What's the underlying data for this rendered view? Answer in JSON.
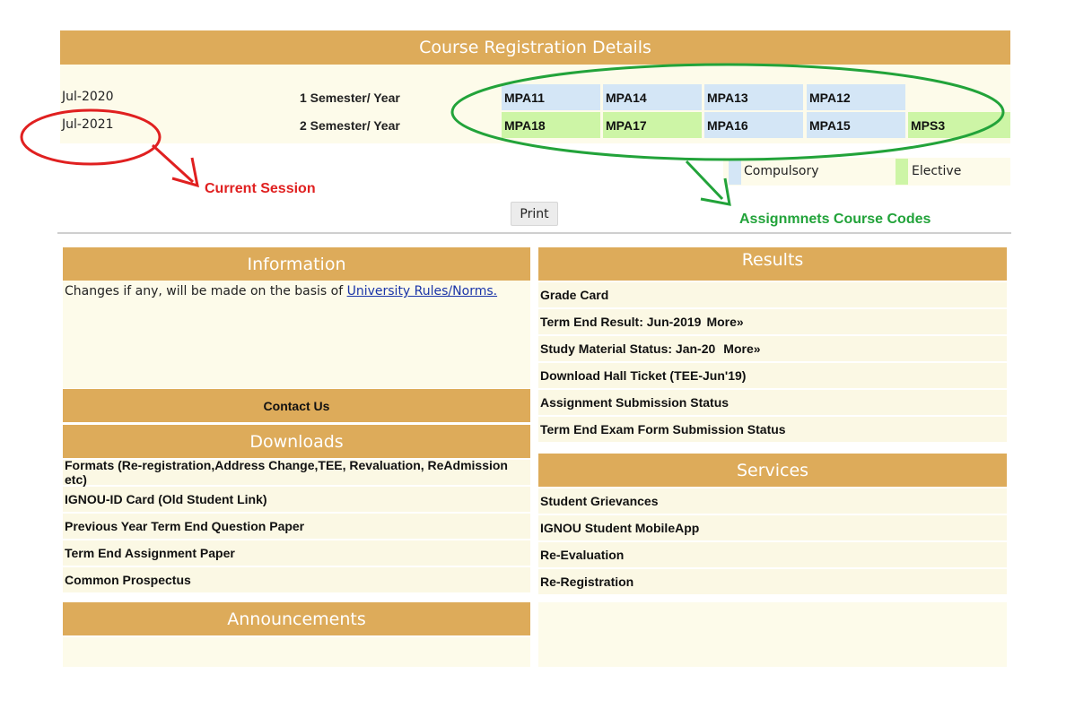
{
  "registration": {
    "title": "Course Registration Details",
    "rows": [
      {
        "session": "Jul-2020",
        "semester": "1 Semester/ Year",
        "courses": [
          {
            "code": "MPA11",
            "type": "compulsory"
          },
          {
            "code": "MPA14",
            "type": "compulsory"
          },
          {
            "code": "MPA13",
            "type": "compulsory"
          },
          {
            "code": "MPA12",
            "type": "compulsory"
          }
        ]
      },
      {
        "session": "Jul-2021",
        "semester": "2 Semester/ Year",
        "courses": [
          {
            "code": "MPA18",
            "type": "elective"
          },
          {
            "code": "MPA17",
            "type": "elective"
          },
          {
            "code": "MPA16",
            "type": "compulsory"
          },
          {
            "code": "MPA15",
            "type": "compulsory"
          },
          {
            "code": "MPS3",
            "type": "elective"
          }
        ]
      }
    ],
    "legend": {
      "compulsory": "Compulsory",
      "elective": "Elective"
    },
    "print_label": "Print"
  },
  "annotations": {
    "current_session": "Current Session",
    "assignment_codes": "Assignmnets Course Codes"
  },
  "information": {
    "title": "Information",
    "text_prefix": "Changes if any, will be made on the basis of ",
    "link_text": "University Rules/Norms."
  },
  "contact_us": "Contact Us",
  "downloads": {
    "title": "Downloads",
    "items": [
      "Formats (Re-registration,Address Change,TEE, Revaluation, ReAdmission etc)",
      "IGNOU-ID Card (Old Student Link)",
      "Previous Year Term End Question Paper",
      "Term End Assignment Paper",
      "Common Prospectus"
    ]
  },
  "announcements": {
    "title": "Announcements"
  },
  "results": {
    "title": "Results",
    "items": [
      {
        "label": "Grade Card",
        "more": ""
      },
      {
        "label": "Term End Result: Jun-2019",
        "more": "More»"
      },
      {
        "label": "Study Material Status: Jan-20",
        "more": "More»"
      },
      {
        "label": "Download Hall Ticket (TEE-Jun'19)",
        "more": ""
      },
      {
        "label": "Assignment Submission Status",
        "more": ""
      },
      {
        "label": "Term End Exam Form Submission Status",
        "more": ""
      }
    ]
  },
  "services": {
    "title": "Services",
    "items": [
      "Student Grievances",
      "IGNOU Student MobileApp",
      "Re-Evaluation",
      "Re-Registration"
    ]
  },
  "colors": {
    "header_gold": "#ddab5a",
    "compulsory": "#d4e6f6",
    "elective": "#cdf5a6",
    "row_bg": "#fbf8e4",
    "annotation_red": "#e02020",
    "annotation_green": "#22a33a"
  }
}
